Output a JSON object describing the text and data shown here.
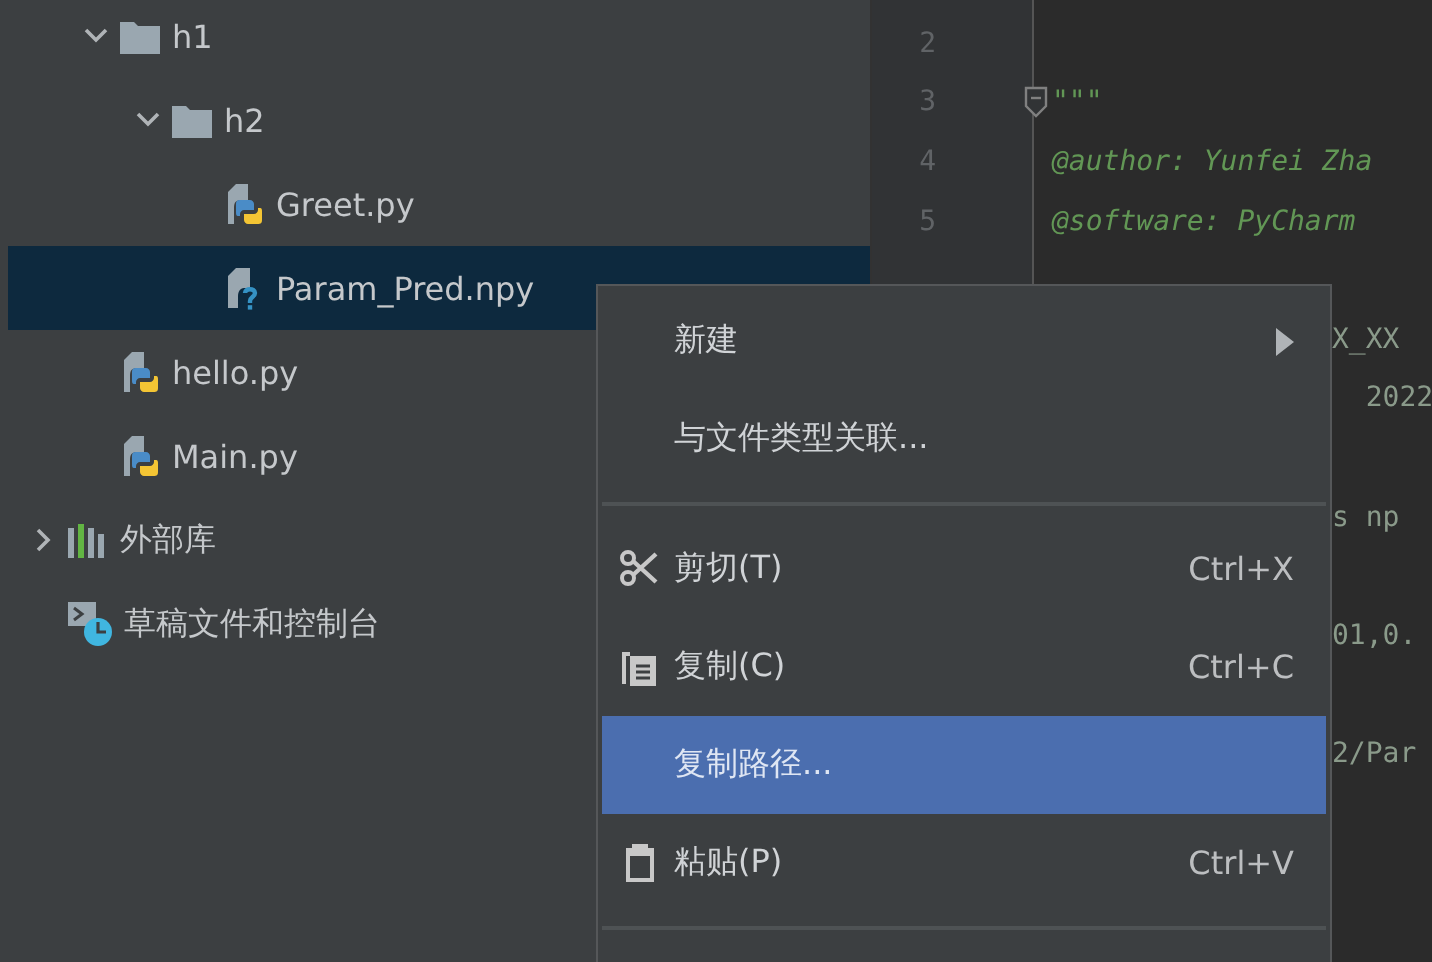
{
  "project_tree": [
    {
      "label": "h1",
      "kind": "folder",
      "expanded": true,
      "selected": false,
      "children": [
        {
          "label": "h2",
          "kind": "folder",
          "expanded": true,
          "selected": false,
          "children": [
            {
              "label": "Greet.py",
              "kind": "python",
              "selected": false
            },
            {
              "label": "Param_Pred.npy",
              "kind": "unknown",
              "selected": true
            }
          ]
        }
      ]
    },
    {
      "label": "hello.py",
      "kind": "python",
      "selected": false
    },
    {
      "label": "Main.py",
      "kind": "python",
      "selected": false
    }
  ],
  "root_nodes": [
    {
      "label": "外部库",
      "kind": "library",
      "expanded": false,
      "selected": false
    },
    {
      "label": "草稿文件和控制台",
      "kind": "scratches",
      "selected": false
    }
  ],
  "editor": {
    "lines": [
      {
        "number": "2",
        "kind": "full"
      },
      {
        "number": "3",
        "text": "\"\"\"",
        "kind": "full",
        "fold": true
      },
      {
        "number": "4",
        "text": "@author: Yunfei Zha",
        "kind": "full"
      },
      {
        "number": "5",
        "text": "@software: PyCharm",
        "kind": "full"
      },
      {
        "kind": "covered"
      },
      {
        "text": "X_XX",
        "kind": "tail"
      },
      {
        "text": "  2022",
        "kind": "tail"
      },
      {
        "kind": "tail"
      },
      {
        "text": "s np",
        "kind": "tail"
      },
      {
        "kind": "tail"
      },
      {
        "text": "01,0.",
        "kind": "tail"
      },
      {
        "kind": "tail"
      },
      {
        "text": "2/Par",
        "kind": "tail"
      }
    ]
  },
  "context_menu": {
    "items": [
      {
        "kind": "item",
        "label": "新建",
        "submenu": true,
        "selected": false
      },
      {
        "kind": "item",
        "label": "与文件类型关联...",
        "selected": false
      },
      {
        "kind": "separator"
      },
      {
        "kind": "cut",
        "label": "剪切(T)",
        "shortcut": "Ctrl+X",
        "selected": false
      },
      {
        "kind": "copy",
        "label": "复制(C)",
        "shortcut": "Ctrl+C",
        "selected": false
      },
      {
        "kind": "item",
        "label": "复制路径...",
        "selected": true
      },
      {
        "kind": "paste",
        "label": "粘贴(P)",
        "shortcut": "Ctrl+V",
        "selected": false
      },
      {
        "kind": "separator"
      }
    ]
  }
}
